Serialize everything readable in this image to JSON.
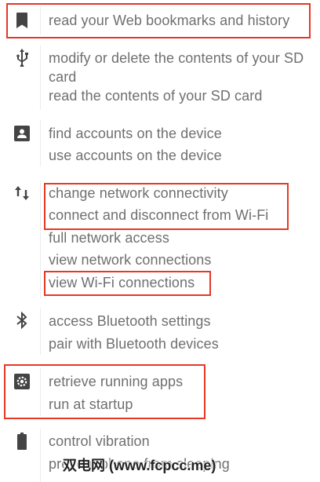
{
  "colors": {
    "highlight": "#e53825",
    "text": "#6f6f6f",
    "icon": "#444444"
  },
  "groups": [
    {
      "icon": "bookmark-icon",
      "items": [
        "read your Web bookmarks and history"
      ]
    },
    {
      "icon": "usb-icon",
      "items": [
        "modify or delete the contents of your SD card",
        "read the contents of your SD card"
      ]
    },
    {
      "icon": "contact-card-icon",
      "items": [
        "find accounts on the device",
        "use accounts on the device"
      ]
    },
    {
      "icon": "swap-arrows-icon",
      "items": [
        "change network connectivity",
        "connect and disconnect from Wi-Fi",
        "full network access",
        "view network connections",
        "view Wi-Fi connections"
      ]
    },
    {
      "icon": "bluetooth-icon",
      "items": [
        "access Bluetooth settings",
        "pair with Bluetooth devices"
      ]
    },
    {
      "icon": "gear-icon",
      "items": [
        "retrieve running apps",
        "run at startup"
      ]
    },
    {
      "icon": "battery-icon",
      "items": [
        "control vibration",
        "prevent phone from sleeping"
      ]
    }
  ],
  "watermark": "双电网 (www.fcpcc.me)"
}
